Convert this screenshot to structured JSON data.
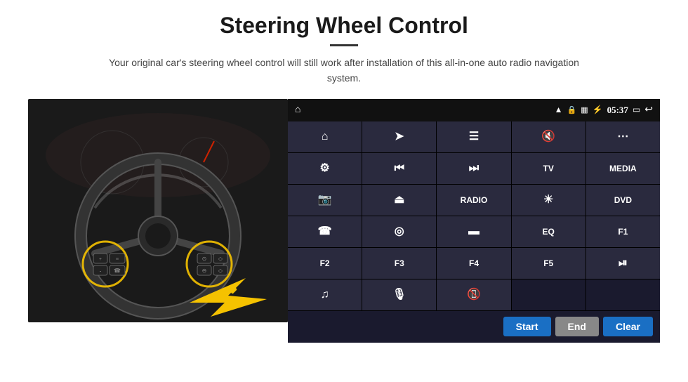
{
  "header": {
    "title": "Steering Wheel Control",
    "subtitle": "Your original car's steering wheel control will still work after installation of this all-in-one auto radio navigation system."
  },
  "divider": "—",
  "statusBar": {
    "time": "05:37",
    "icons": [
      "wifi",
      "lock",
      "sd",
      "bluetooth",
      "screen",
      "back"
    ]
  },
  "buttons": [
    {
      "id": "home",
      "type": "icon",
      "icon": "home",
      "label": ""
    },
    {
      "id": "nav",
      "type": "icon",
      "icon": "nav",
      "label": ""
    },
    {
      "id": "menu",
      "type": "icon",
      "icon": "menu",
      "label": ""
    },
    {
      "id": "vol-mute",
      "type": "icon",
      "icon": "vol-mute",
      "label": ""
    },
    {
      "id": "apps",
      "type": "icon",
      "icon": "apps",
      "label": ""
    },
    {
      "id": "settings",
      "type": "icon",
      "icon": "settings",
      "label": ""
    },
    {
      "id": "prev",
      "type": "icon",
      "icon": "prev",
      "label": ""
    },
    {
      "id": "next",
      "type": "icon",
      "icon": "next",
      "label": ""
    },
    {
      "id": "tv",
      "type": "text",
      "label": "TV"
    },
    {
      "id": "media",
      "type": "text",
      "label": "MEDIA"
    },
    {
      "id": "camera",
      "type": "icon",
      "icon": "camera",
      "label": ""
    },
    {
      "id": "eject",
      "type": "icon",
      "icon": "eject",
      "label": ""
    },
    {
      "id": "radio",
      "type": "text",
      "label": "RADIO"
    },
    {
      "id": "brightness",
      "type": "icon",
      "icon": "brightness",
      "label": ""
    },
    {
      "id": "dvd",
      "type": "text",
      "label": "DVD"
    },
    {
      "id": "phone",
      "type": "icon",
      "icon": "phone",
      "label": ""
    },
    {
      "id": "browser",
      "type": "icon",
      "icon": "browser",
      "label": ""
    },
    {
      "id": "screen",
      "type": "icon",
      "icon": "screen",
      "label": ""
    },
    {
      "id": "eq",
      "type": "text",
      "label": "EQ"
    },
    {
      "id": "f1",
      "type": "text",
      "label": "F1"
    },
    {
      "id": "f2",
      "type": "text",
      "label": "F2"
    },
    {
      "id": "f3",
      "type": "text",
      "label": "F3"
    },
    {
      "id": "f4",
      "type": "text",
      "label": "F4"
    },
    {
      "id": "f5",
      "type": "text",
      "label": "F5"
    },
    {
      "id": "play-pause",
      "type": "icon",
      "icon": "play-pause",
      "label": ""
    },
    {
      "id": "music",
      "type": "icon",
      "icon": "music",
      "label": ""
    },
    {
      "id": "mic",
      "type": "icon",
      "icon": "mic",
      "label": ""
    },
    {
      "id": "call-end",
      "type": "icon",
      "icon": "call-end",
      "label": ""
    },
    {
      "id": "empty1",
      "type": "empty",
      "label": ""
    },
    {
      "id": "empty2",
      "type": "empty",
      "label": ""
    }
  ],
  "bottomBar": {
    "startLabel": "Start",
    "endLabel": "End",
    "clearLabel": "Clear"
  },
  "colors": {
    "accent": "#1a6fc4",
    "panelBg": "#1a1a2e",
    "btnBg": "#2a2a3e",
    "statusBg": "#111"
  }
}
